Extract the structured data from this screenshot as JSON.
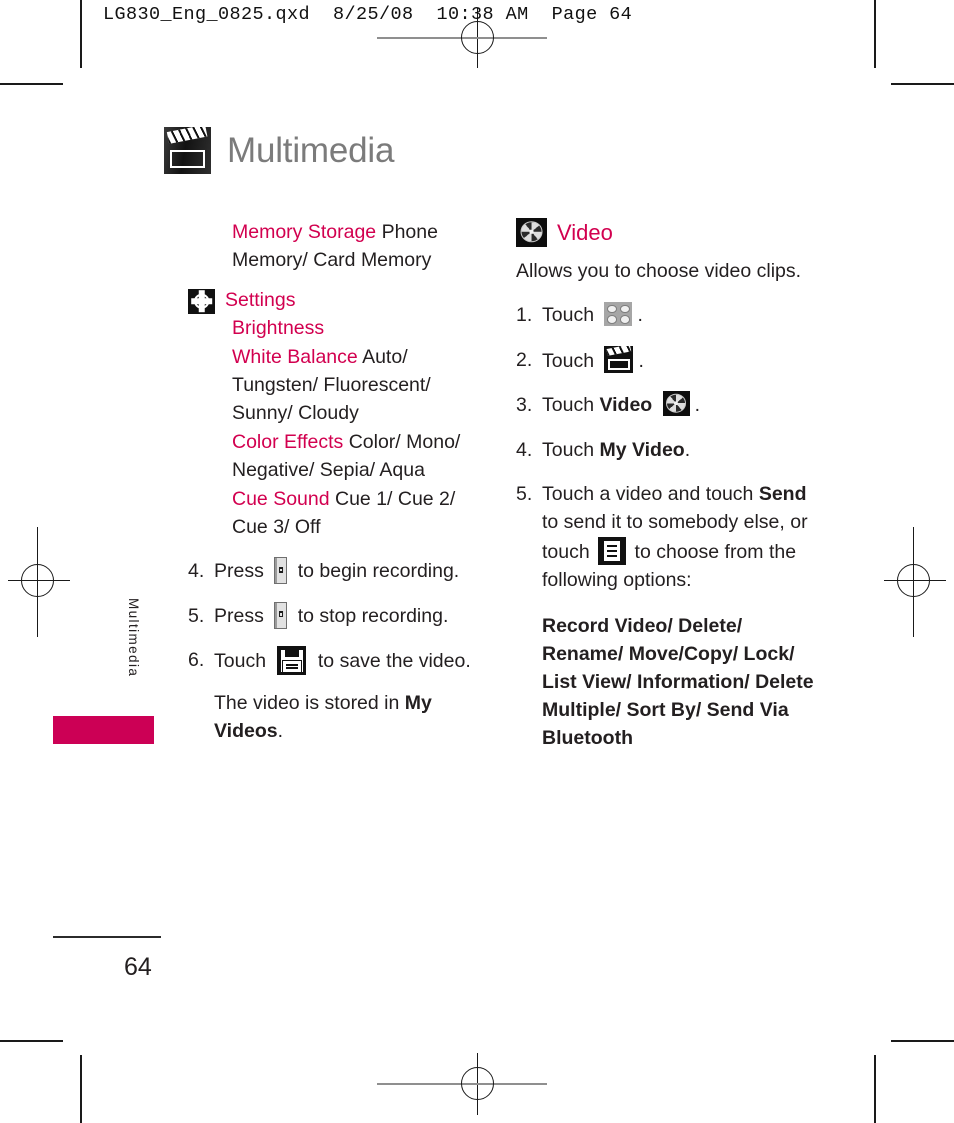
{
  "slug": "LG830_Eng_0825.qxd  8/25/08  10:38 AM  Page 64",
  "page_number": "64",
  "colors": {
    "accent_magenta": "#d2004f",
    "sidebar_bar": "#cc0055",
    "title_grey": "#7b7b7b",
    "body_black": "#231f20"
  },
  "sidebar": {
    "tab_label": "Multimedia"
  },
  "page_title": {
    "text": "Multimedia",
    "icon": "clapperboard-icon"
  },
  "left_column": {
    "memory_storage": {
      "heading": "Memory Storage",
      "values": "Phone Memory/ Card Memory"
    },
    "settings": {
      "icon": "gear-icon",
      "heading": "Settings",
      "items": [
        {
          "heading": "Brightness",
          "values": ""
        },
        {
          "heading": "White Balance",
          "values": "Auto/ Tungsten/ Fluorescent/ Sunny/ Cloudy"
        },
        {
          "heading": "Color Effects",
          "values": "Color/ Mono/ Negative/ Sepia/ Aqua"
        },
        {
          "heading": "Cue Sound",
          "values": "Cue 1/ Cue 2/ Cue 3/ Off"
        }
      ]
    },
    "steps": [
      {
        "num": "4.",
        "pre": "Press",
        "icon": "side-key-icon",
        "post": "to begin recording."
      },
      {
        "num": "5.",
        "pre": "Press",
        "icon": "side-key-icon",
        "post": "to stop recording."
      },
      {
        "num": "6.",
        "pre": "Touch",
        "icon": "save-icon",
        "post": "to save the video."
      }
    ],
    "note": {
      "text_before": "The video is stored in ",
      "bold": "My Videos",
      "text_after": "."
    }
  },
  "right_column": {
    "section": {
      "icon": "film-reel-icon",
      "heading": "Video",
      "description": "Allows you to choose video clips."
    },
    "steps": [
      {
        "num": "1.",
        "pre": "Touch",
        "icon": "grid-icon",
        "post": "."
      },
      {
        "num": "2.",
        "pre": "Touch",
        "icon": "clapperboard-icon",
        "post": "."
      },
      {
        "num": "3.",
        "pre": "Touch",
        "bold": "Video",
        "icon": "film-reel-icon",
        "post": "."
      },
      {
        "num": "4.",
        "pre": "Touch",
        "bold": "My Video",
        "post": "."
      }
    ],
    "step5": {
      "num": "5.",
      "part1": "Touch a video and touch ",
      "bold1": "Send",
      "part2": " to send it to somebody else, or touch ",
      "icon": "menu-icon",
      "part3": " to choose from the following options:"
    },
    "options_list": "Record Video/ Delete/ Rename/ Move/Copy/ Lock/ List View/ Information/ Delete Multiple/ Sort By/ Send Via Bluetooth"
  }
}
